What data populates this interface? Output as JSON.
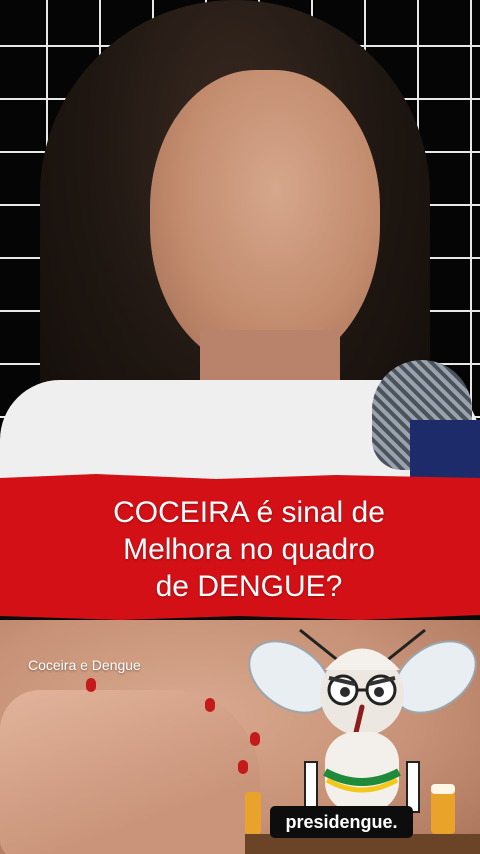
{
  "banner": {
    "lines": [
      "COCEIRA é sinal de",
      "Melhora no quadro",
      "de DENGUE?"
    ]
  },
  "overlay": {
    "label": "Coceira e Dengue"
  },
  "brand": {
    "handle": "presidengue."
  },
  "colors": {
    "banner_red": "#d21016",
    "grid_line": "#e8e8e8",
    "text_white": "#ffffff"
  }
}
